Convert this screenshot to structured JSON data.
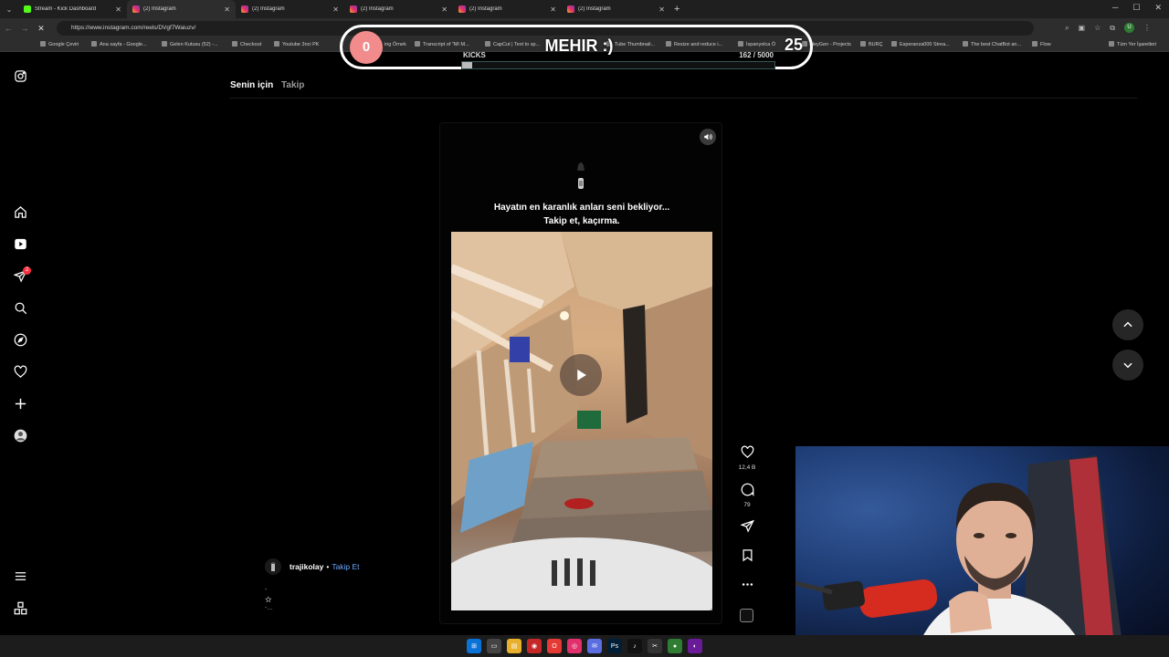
{
  "browser": {
    "tabs": [
      {
        "title": "Stream - Kick Dashboard",
        "favicon": "kick-icon",
        "active": false
      },
      {
        "title": "(2) Instagram",
        "favicon": "instagram-icon",
        "active": true
      },
      {
        "title": "(2) Instagram",
        "favicon": "instagram-icon",
        "active": false
      },
      {
        "title": "(2) Instagram",
        "favicon": "instagram-icon",
        "active": false
      },
      {
        "title": "(2) Instagram",
        "favicon": "instagram-icon",
        "active": false
      },
      {
        "title": "(2) Instagram",
        "favicon": "instagram-icon",
        "active": false
      }
    ],
    "url": "https://www.instagram.com/reels/DVgf7Waiuzv/",
    "profile_initial": "U",
    "bookmarks": [
      "Google Çeviri",
      "Ana sayfa - Google...",
      "Gelen Kutusu (52) -...",
      "Checkout",
      "Youtube 3nci PK",
      "ing Örnek",
      "Transcript of \"MI M...",
      "CapCut | Text to sp...",
      "Tube Thumbnail...",
      "Resize and reduce i...",
      "İspanyolca Ö",
      "HeyGen - Projects",
      "BURÇ",
      "Esperanza000 Strea...",
      "The best ChatBot an...",
      "Flow",
      "Tüm Yer İşaretleri"
    ]
  },
  "overlay": {
    "left_score": "0",
    "name": "MEHIR :)",
    "right_score": "25",
    "kicks_label": "KICKS",
    "kicks_count": "162 / 5000",
    "kicks_progress": 0.0324
  },
  "instagram": {
    "feed_tabs": {
      "for_you": "Senin için",
      "following": "Takip"
    },
    "notification_count": "2",
    "reel": {
      "caption_line1": "Hayatın en karanlık anları seni bekliyor...",
      "caption_line2": "Takip et, kaçırma.",
      "likes": "12,4 B",
      "comments": "79",
      "author": "trajikolay",
      "separator": "•",
      "follow_label": "Takip Et",
      "desc_line1": "-",
      "desc_line2": "-..."
    }
  },
  "colors": {
    "accent_red": "#ff3040",
    "follow_blue": "#6ea8ff",
    "score_circle": "#f28c8c",
    "kick_green": "#53fc18"
  }
}
